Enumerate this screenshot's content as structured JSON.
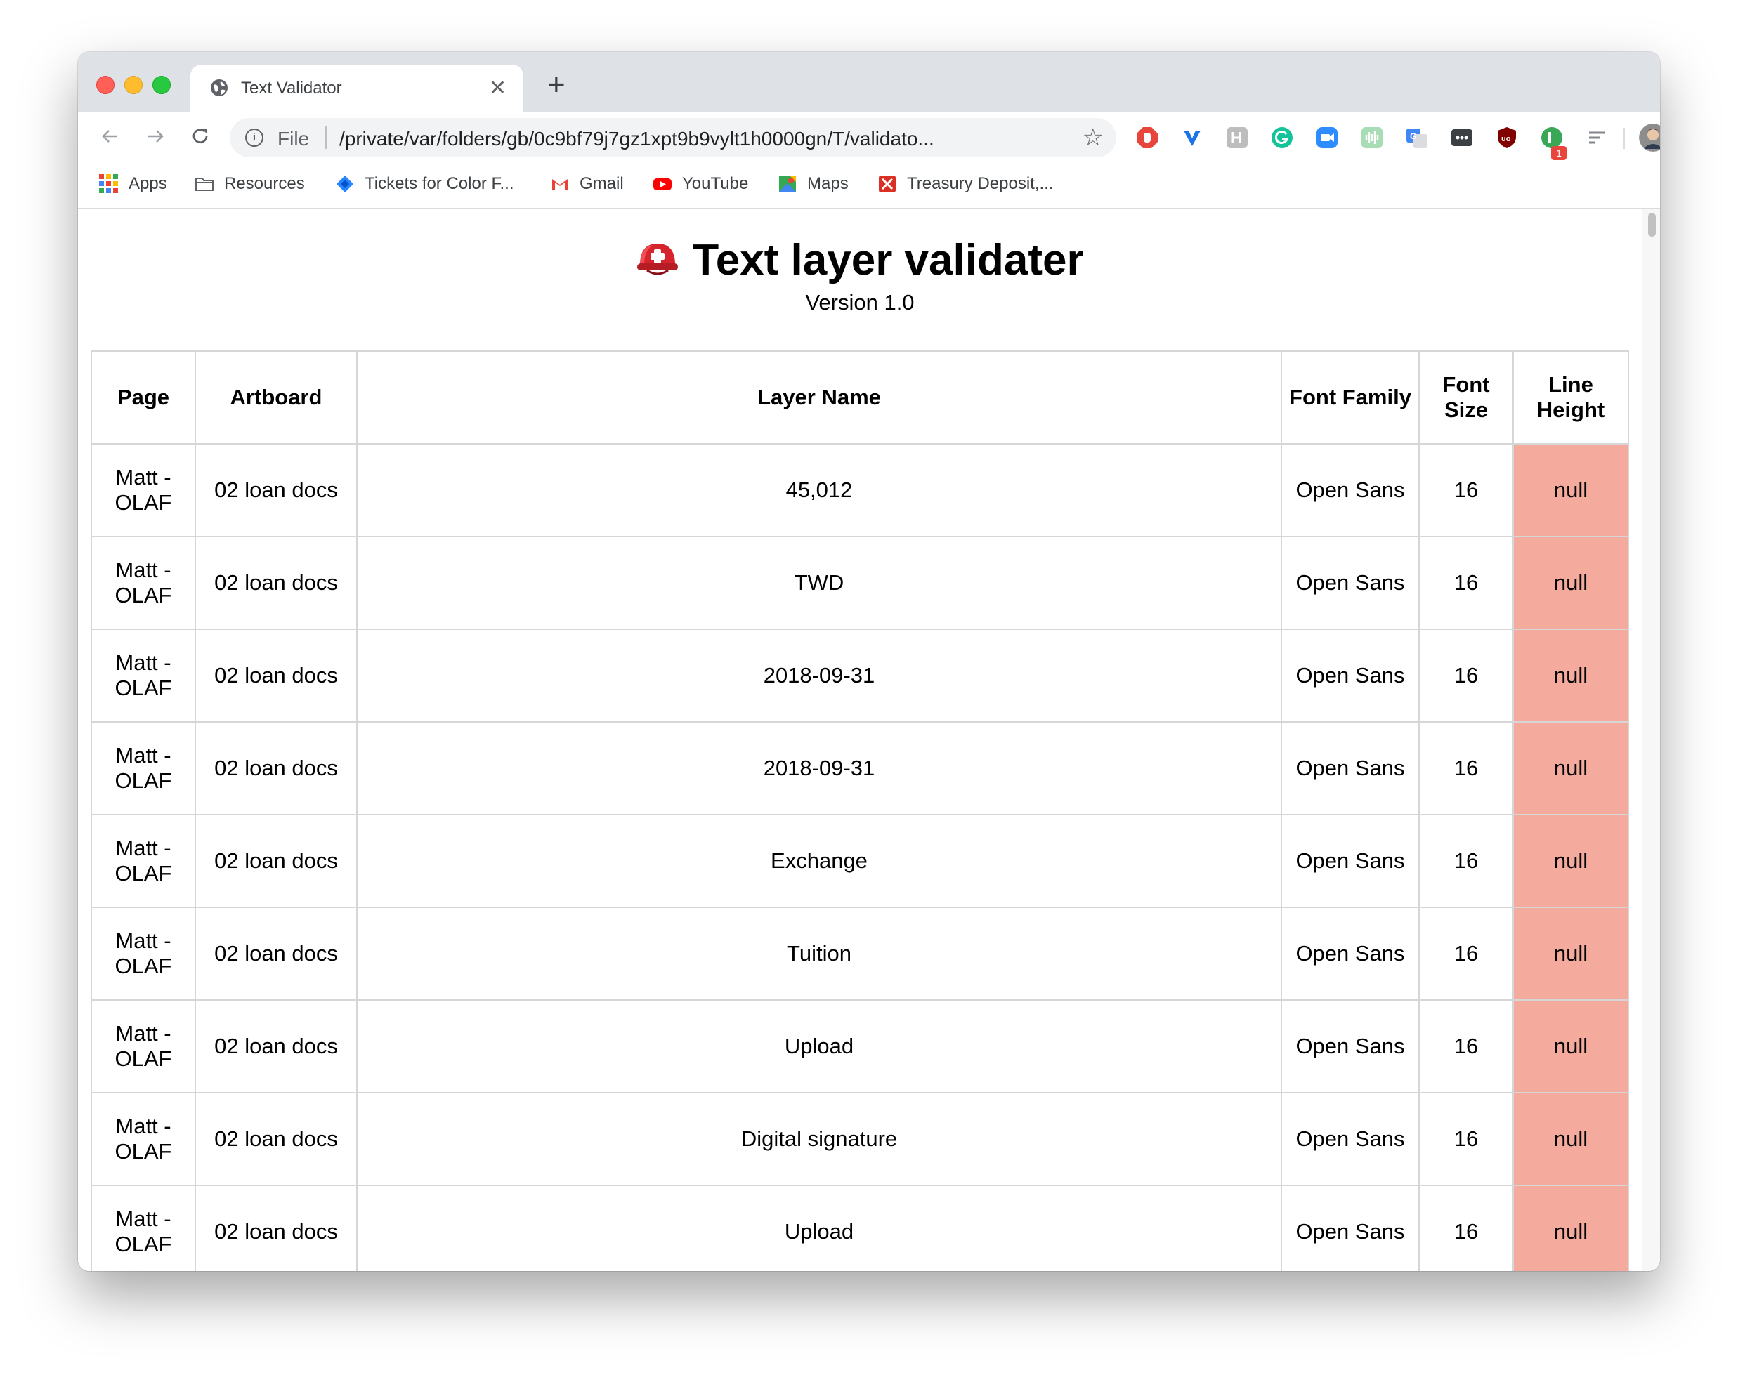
{
  "browser": {
    "tab_title": "Text Validator",
    "new_tab_symbol": "+",
    "close_symbol": "✕",
    "omnibox": {
      "scheme_label": "File",
      "url": "/private/var/folders/gb/0c9bf79j7gz1xpt9b9vylt1h0000gn/T/validato..."
    },
    "extension_badge": "1",
    "bookmarks": [
      {
        "label": "Apps",
        "icon": "apps-grid-icon"
      },
      {
        "label": "Resources",
        "icon": "folder-icon"
      },
      {
        "label": "Tickets for Color F...",
        "icon": "jira-icon"
      },
      {
        "label": "Gmail",
        "icon": "gmail-icon"
      },
      {
        "label": "YouTube",
        "icon": "youtube-icon"
      },
      {
        "label": "Maps",
        "icon": "maps-icon"
      },
      {
        "label": "Treasury Deposit,...",
        "icon": "treasury-icon"
      }
    ]
  },
  "page": {
    "title": "Text layer validater",
    "version": "Version 1.0",
    "table": {
      "headers": [
        "Page",
        "Artboard",
        "Layer Name",
        "Font Family",
        "Font Size",
        "Line Height"
      ],
      "rows": [
        [
          "Matt - OLAF",
          "02 loan docs",
          "45,012",
          "Open Sans",
          "16",
          "null"
        ],
        [
          "Matt - OLAF",
          "02 loan docs",
          "TWD",
          "Open Sans",
          "16",
          "null"
        ],
        [
          "Matt - OLAF",
          "02 loan docs",
          "2018-09-31",
          "Open Sans",
          "16",
          "null"
        ],
        [
          "Matt - OLAF",
          "02 loan docs",
          "2018-09-31",
          "Open Sans",
          "16",
          "null"
        ],
        [
          "Matt - OLAF",
          "02 loan docs",
          "Exchange",
          "Open Sans",
          "16",
          "null"
        ],
        [
          "Matt - OLAF",
          "02 loan docs",
          "Tuition",
          "Open Sans",
          "16",
          "null"
        ],
        [
          "Matt - OLAF",
          "02 loan docs",
          "Upload",
          "Open Sans",
          "16",
          "null"
        ],
        [
          "Matt - OLAF",
          "02 loan docs",
          "Digital signature",
          "Open Sans",
          "16",
          "null"
        ],
        [
          "Matt - OLAF",
          "02 loan docs",
          "Upload",
          "Open Sans",
          "16",
          "null"
        ]
      ]
    }
  },
  "colors": {
    "null_cell": "#f4aa9c",
    "tab_strip": "#dee1e6"
  }
}
